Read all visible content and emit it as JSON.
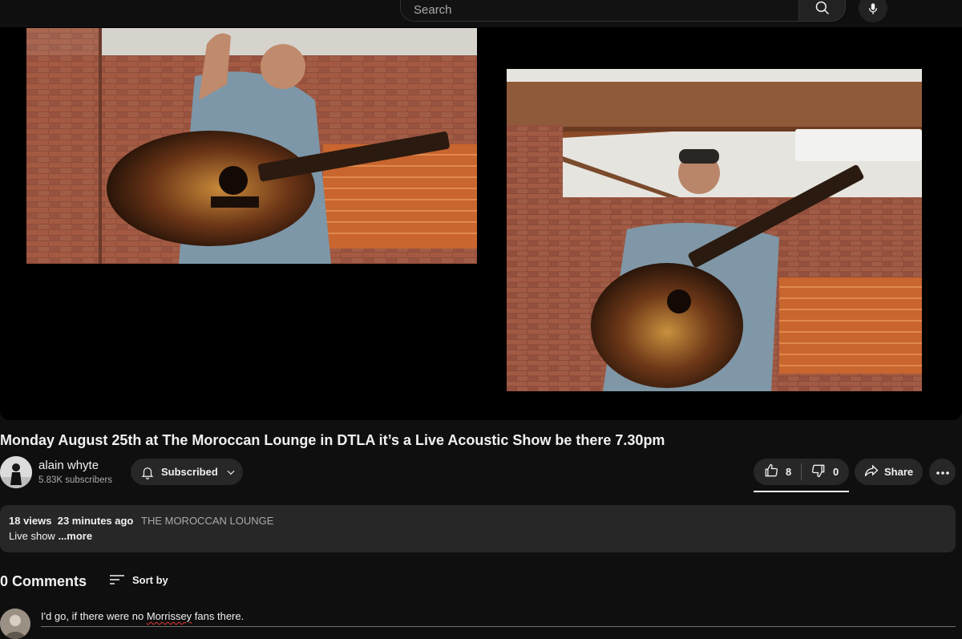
{
  "search": {
    "placeholder": "Search"
  },
  "video": {
    "title": "Monday August 25th at The Moroccan Lounge in DTLA it’s a Live Acoustic Show be there 7.30pm"
  },
  "channel": {
    "name": "alain whyte",
    "subscribers": "5.83K subscribers",
    "subscribe_label": "Subscribed"
  },
  "actions": {
    "likes": "8",
    "dislikes": "0",
    "share_label": "Share"
  },
  "description": {
    "views": "18 views",
    "posted": "23 minutes ago",
    "location_tag": "THE MOROCCAN LOUNGE",
    "text": "Live show",
    "more_label": "...more"
  },
  "comments": {
    "count_label": "0 Comments",
    "sort_label": "Sort by",
    "draft_before": "I'd go, if there were no ",
    "draft_misspelled": "Morrissey",
    "draft_after": " fans there."
  },
  "colors": {
    "background": "#0f0f0f",
    "surface": "#272727",
    "text_primary": "#f1f1f1",
    "text_secondary": "#aaaaaa"
  }
}
